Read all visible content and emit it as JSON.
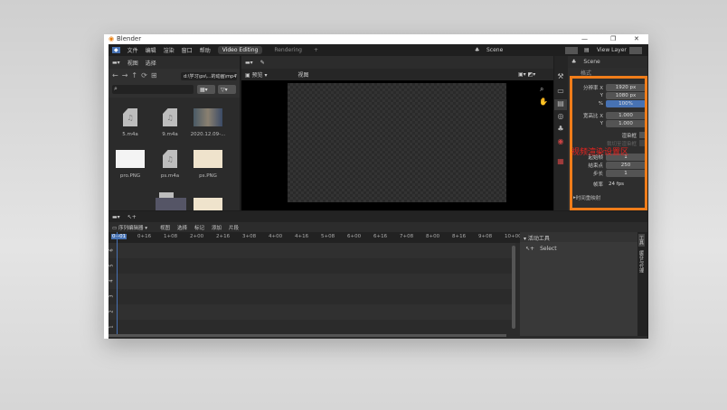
{
  "window": {
    "title": "Blender",
    "minimize": "—",
    "maximize": "❐",
    "close": "✕"
  },
  "menu": {
    "items": [
      "文件",
      "编辑",
      "渲染",
      "窗口",
      "帮助"
    ],
    "tabs": [
      "Video Editing",
      "Rendering"
    ],
    "add_tab": "+",
    "scene": "Scene",
    "view_layer": "View Layer"
  },
  "file_browser": {
    "menu": [
      "视图",
      "选择"
    ],
    "path": "d:\\学习\\ps\\...的动画\\mp4\\",
    "files": [
      {
        "name": "5.m4a",
        "type": "audio"
      },
      {
        "name": "9.m4a",
        "type": "audio"
      },
      {
        "name": "2020.12.09-...",
        "type": "video"
      },
      {
        "name": "pro.PNG",
        "type": "image"
      },
      {
        "name": "ps.m4a",
        "type": "audio"
      },
      {
        "name": "ps.PNG",
        "type": "image"
      }
    ]
  },
  "preview": {
    "mode": "预览",
    "menu": "视图"
  },
  "properties": {
    "scene": "Scene",
    "section": "格式",
    "rows": [
      {
        "label": "分辨率 X",
        "value": "1920 px"
      },
      {
        "label": "Y",
        "value": "1080 px"
      },
      {
        "label": "%",
        "value": "100%"
      },
      {
        "label": "宽高比 X",
        "value": "1.000"
      },
      {
        "label": "Y",
        "value": "1.000"
      }
    ],
    "render_region": "渲染框",
    "crop": "裁切至渲染框",
    "frames": [
      {
        "label": "起始帧",
        "value": "1"
      },
      {
        "label": "结束点",
        "value": "250"
      },
      {
        "label": "步长",
        "value": "1"
      }
    ],
    "frame_rate_label": "帧率",
    "frame_rate": "24 fps",
    "time_remap": "时间重映射"
  },
  "annotation": {
    "text": "视频渲染设置区",
    "color": "#e8231f",
    "box_color": "#f07d1a"
  },
  "sequencer": {
    "editor": "序列编辑器",
    "menu": [
      "视图",
      "选择",
      "标记",
      "添加",
      "片段"
    ],
    "ruler": [
      "0+01",
      "0+16",
      "1+08",
      "2+00",
      "2+16",
      "3+08",
      "4+00",
      "4+16",
      "5+08",
      "6+00",
      "6+16",
      "7+08",
      "8+00",
      "8+16",
      "9+08",
      "10+00"
    ],
    "channels": [
      "6",
      "5",
      "4",
      "3",
      "2",
      "1"
    ],
    "sidebar": {
      "title": "活动工具",
      "tool": "Select"
    },
    "side_tabs": [
      "工具",
      "缓存与代理"
    ]
  }
}
